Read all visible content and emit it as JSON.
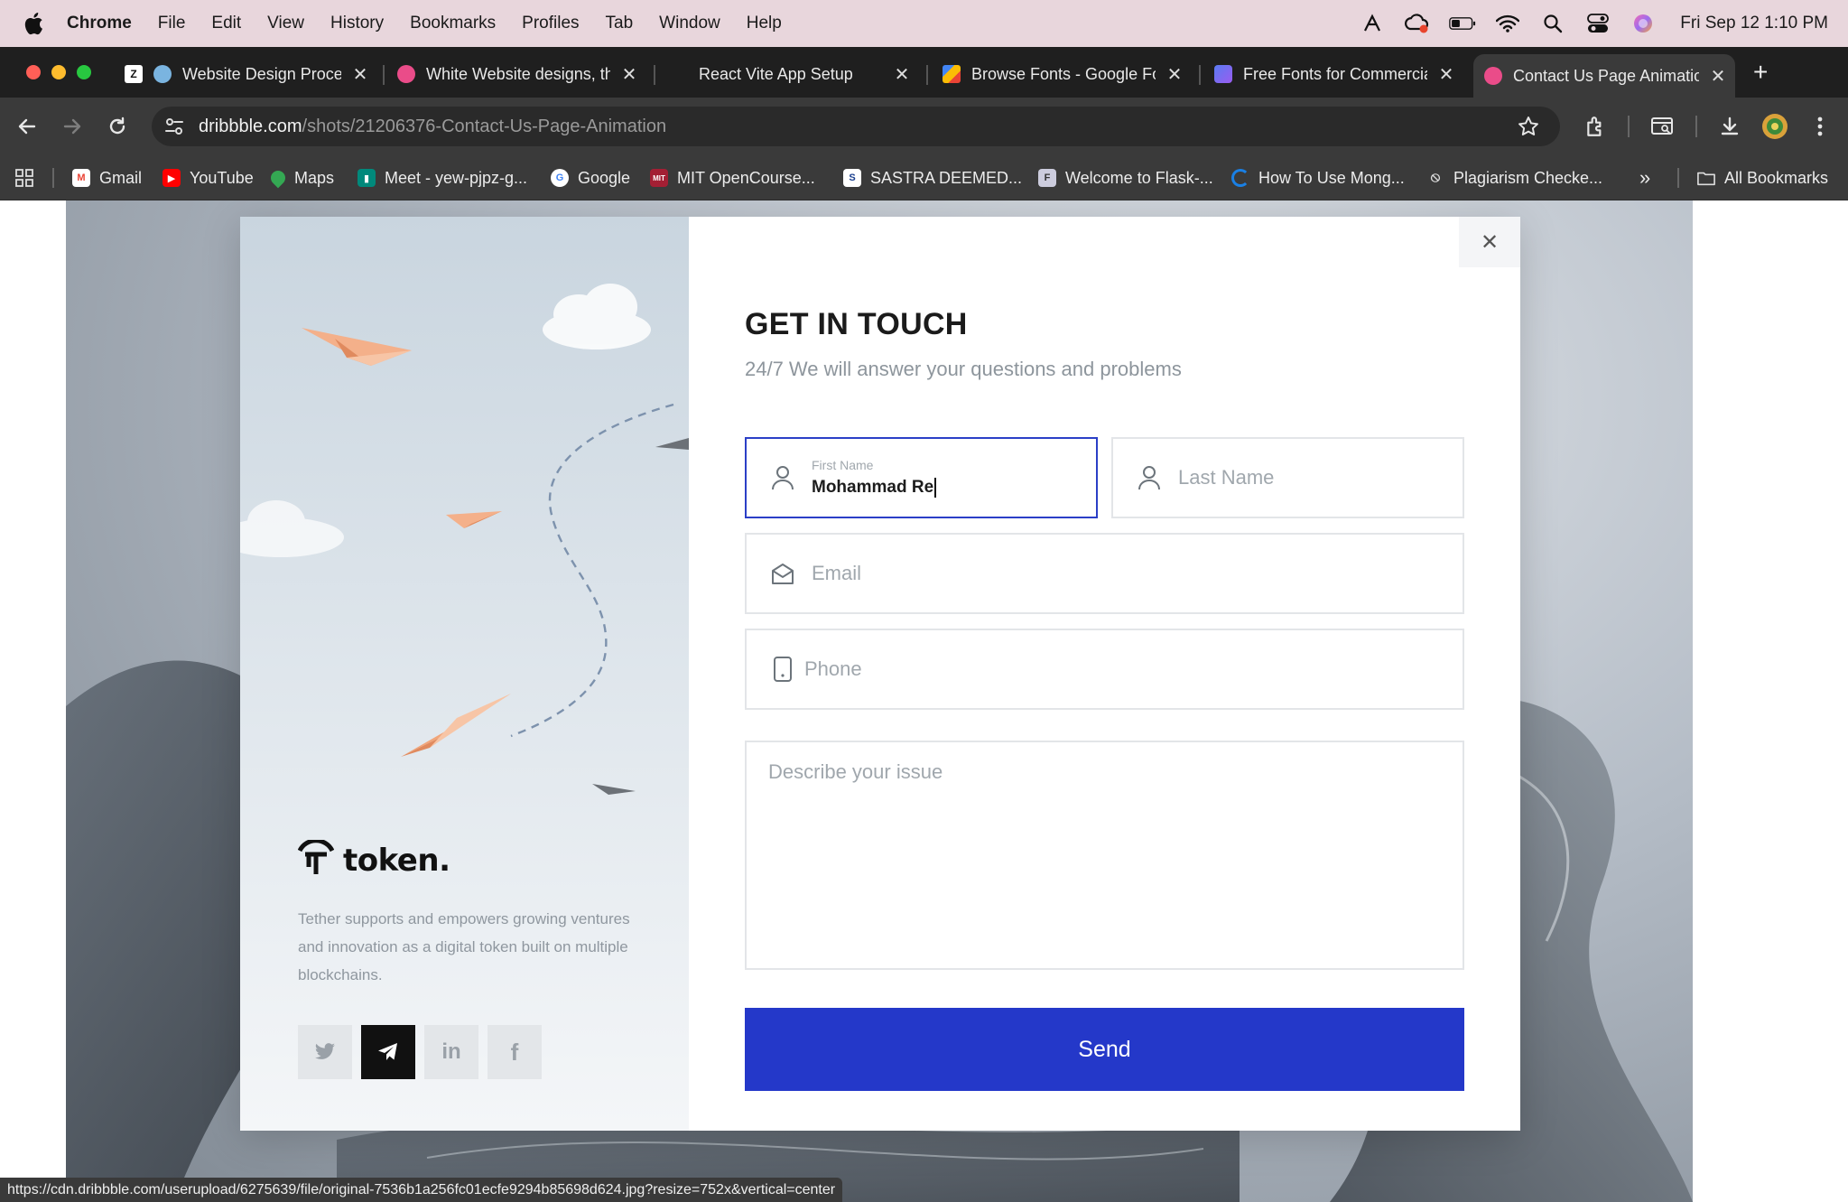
{
  "menubar": {
    "app": "Chrome",
    "items": [
      "File",
      "Edit",
      "View",
      "History",
      "Bookmarks",
      "Profiles",
      "Tab",
      "Window",
      "Help"
    ],
    "clock": "Fri Sep 12  1:10 PM"
  },
  "tabs": [
    {
      "title": "Website Design Process",
      "active": false
    },
    {
      "title": "White Website designs, themes",
      "active": false
    },
    {
      "title": "React Vite App Setup",
      "active": false
    },
    {
      "title": "Browse Fonts - Google Fonts",
      "active": false
    },
    {
      "title": "Free Fonts for Commercial Use",
      "active": false
    },
    {
      "title": "Contact Us Page Animation",
      "active": true
    }
  ],
  "omnibox": {
    "domain": "dribbble.com",
    "path": "/shots/21206376-Contact-Us-Page-Animation"
  },
  "bookmarks": [
    "Gmail",
    "YouTube",
    "Maps",
    "Meet - yew-pjpz-g...",
    "Google",
    "MIT OpenCourse...",
    "SASTRA DEEMED...",
    "Welcome to Flask-...",
    "How To Use Mong...",
    "Plagiarism Checke..."
  ],
  "bookmarks_all": "All Bookmarks",
  "contact": {
    "brand": "token.",
    "tagline": "Tether supports and empowers growing ventures and innovation as a digital token built on multiple blockchains.",
    "title": "GET IN TOUCH",
    "subtitle": "24/7  We will answer your questions and problems",
    "first_name_label": "First Name",
    "first_name_value": "Mohammad Re",
    "last_name_placeholder": "Last Name",
    "email_placeholder": "Email",
    "phone_placeholder": "Phone",
    "issue_placeholder": "Describe your issue",
    "send_label": "Send",
    "social": [
      "twitter",
      "telegram",
      "linkedin",
      "facebook"
    ]
  },
  "status_url": "https://cdn.dribbble.com/userupload/6275639/file/original-7536b1a256fc01ecfe9294b85698d624.jpg?resize=752x&vertical=center",
  "colors": {
    "accent": "#2438c9",
    "focus_border": "#2b3fc7",
    "plane": "#f2a77e"
  }
}
